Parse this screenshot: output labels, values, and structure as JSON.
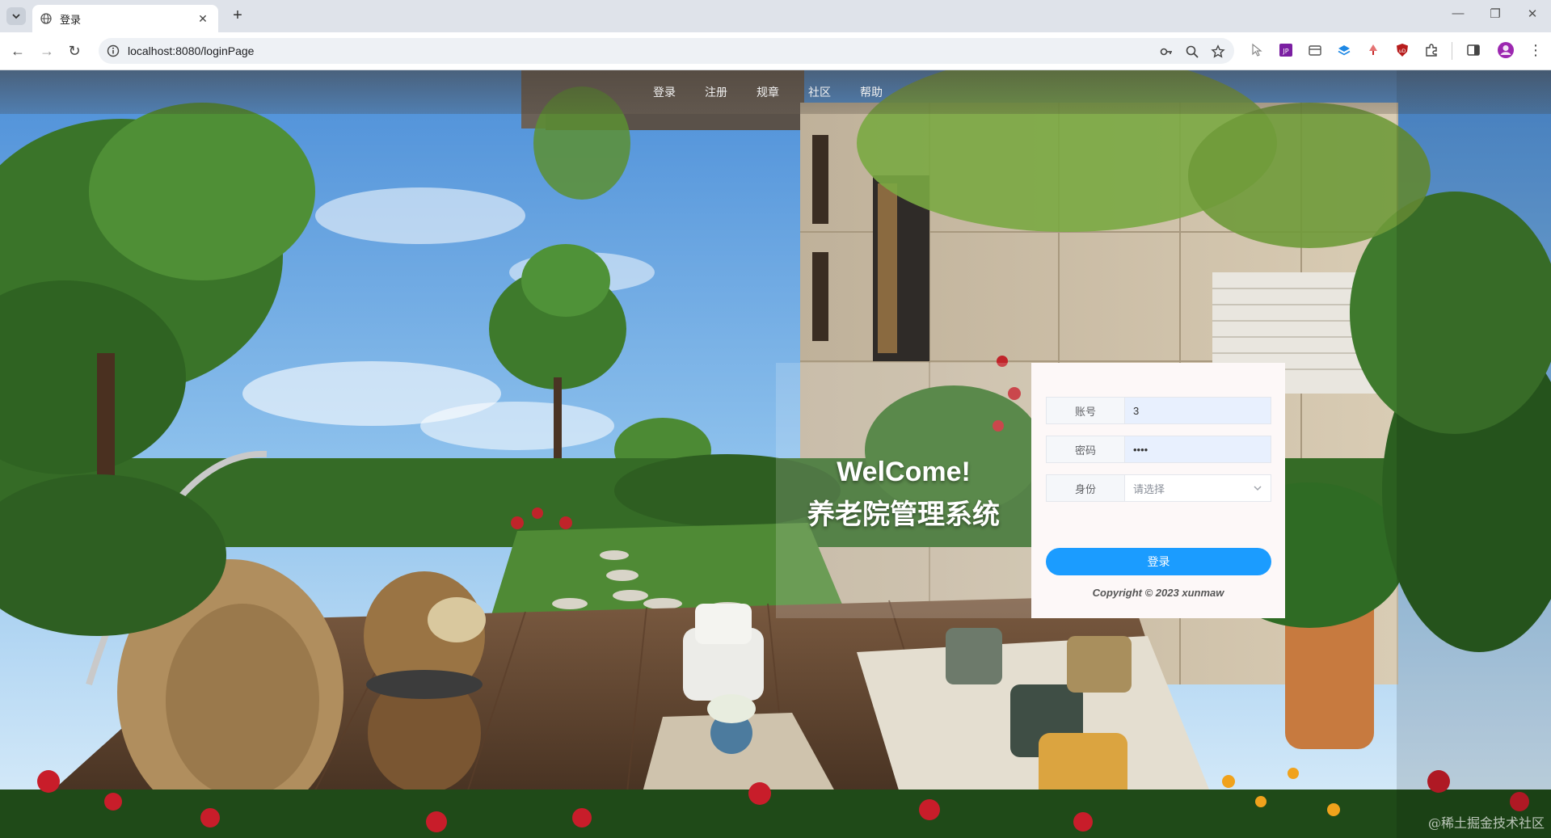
{
  "browser": {
    "tab_title": "登录",
    "url": "localhost:8080/loginPage"
  },
  "nav": {
    "items": [
      "登录",
      "注册",
      "规章",
      "社区",
      "帮助"
    ]
  },
  "hero": {
    "welcome": "WelCome!",
    "system_name": "养老院管理系统"
  },
  "login": {
    "account_label": "账号",
    "account_value": "3",
    "password_label": "密码",
    "password_value": "••••",
    "role_label": "身份",
    "role_placeholder": "请选择",
    "submit_label": "登录",
    "copyright": "Copyright © 2023 xunmaw"
  },
  "watermark": "@稀土掘金技术社区",
  "colors": {
    "primary_button": "#1b9cff",
    "autofill_bg": "#e8f0fe",
    "card_bg": "#fdf8f8"
  }
}
